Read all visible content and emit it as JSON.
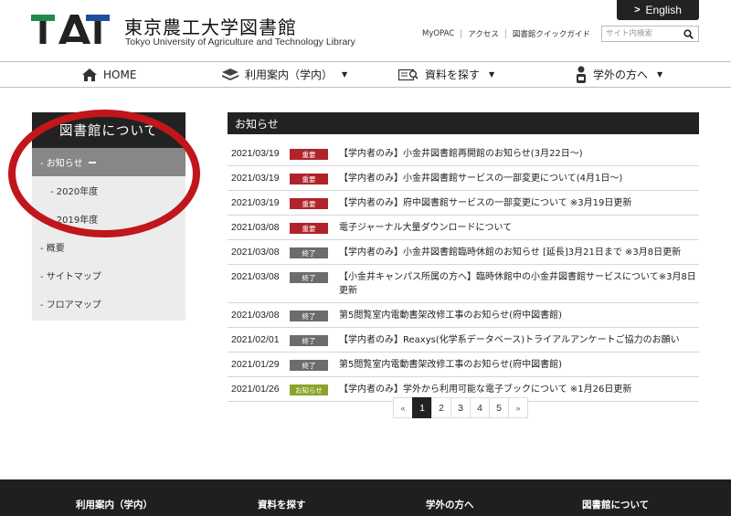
{
  "header": {
    "title": "東京農工大学図書館",
    "subtitle": "Tokyo University of Agriculture and Technology Library",
    "logo_text": "TAT",
    "english_label": "English",
    "util_links": [
      "MyOPAC",
      "アクセス",
      "図書館クイックガイド"
    ],
    "search_placeholder": "サイト内検索"
  },
  "nav": {
    "items": [
      {
        "label": "HOME",
        "icon": "home-icon"
      },
      {
        "label": "利用案内（学内）",
        "icon": "books-icon"
      },
      {
        "label": "資料を探す",
        "icon": "search-doc-icon"
      },
      {
        "label": "学外の方へ",
        "icon": "person-icon"
      }
    ]
  },
  "sidebar": {
    "title": "図書館について",
    "items": [
      {
        "label": "- お知らせ",
        "active": true
      },
      {
        "label": "- 2020年度"
      },
      {
        "label": "- 2019年度"
      },
      {
        "label": "- 概要"
      },
      {
        "label": "- サイトマップ"
      },
      {
        "label": "- フロアマップ"
      }
    ]
  },
  "news": {
    "heading": "お知らせ",
    "rows": [
      {
        "date": "2021/03/19",
        "badge": "重要",
        "title": "【学内者のみ】小金井図書館再開館のお知らせ(3月22日〜)"
      },
      {
        "date": "2021/03/19",
        "badge": "重要",
        "title": "【学内者のみ】小金井図書館サービスの一部変更について(4月1日〜)"
      },
      {
        "date": "2021/03/19",
        "badge": "重要",
        "title": "【学内者のみ】府中図書館サービスの一部変更について ※3月19日更新"
      },
      {
        "date": "2021/03/08",
        "badge": "重要",
        "title": "電子ジャーナル大量ダウンロードについて"
      },
      {
        "date": "2021/03/08",
        "badge": "終了",
        "title": "【学内者のみ】小金井図書館臨時休館のお知らせ [延長]3月21日まで ※3月8日更新"
      },
      {
        "date": "2021/03/08",
        "badge": "終了",
        "title": "【小金井キャンパス所属の方へ】臨時休館中の小金井図書館サービスについて※3月8日更新"
      },
      {
        "date": "2021/03/08",
        "badge": "終了",
        "title": "第5閲覧室内電動書架改修工事のお知らせ(府中図書館)"
      },
      {
        "date": "2021/02/01",
        "badge": "終了",
        "title": "【学内者のみ】Reaxys(化学系データベース)トライアルアンケートご協力のお願い"
      },
      {
        "date": "2021/01/29",
        "badge": "終了",
        "title": "第5閲覧室内電動書架改修工事のお知らせ(府中図書館)"
      },
      {
        "date": "2021/01/26",
        "badge": "お知らせ",
        "title": "【学内者のみ】学外から利用可能な電子ブックについて ※1月26日更新"
      }
    ]
  },
  "pagination": {
    "prev": "«",
    "pages": [
      "1",
      "2",
      "3",
      "4",
      "5"
    ],
    "current": "1",
    "next": "»"
  },
  "footer": {
    "columns": [
      "利用案内（学内）",
      "資料を探す",
      "学外の方へ",
      "図書館について"
    ]
  },
  "colors": {
    "badge_important": "#b0232a",
    "badge_ended": "#6c6c6c",
    "badge_notice": "#8aa32b",
    "logo_green": "#1f8a4c",
    "logo_blue": "#1f4f9c",
    "annotation_red": "#c0161c"
  }
}
